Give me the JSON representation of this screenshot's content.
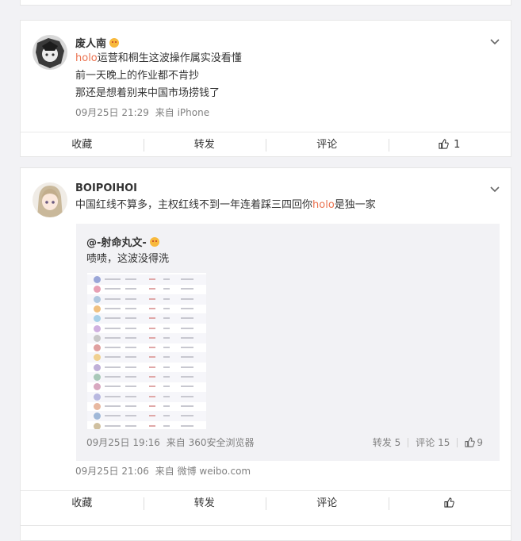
{
  "top_bar": {
    "labels": [
      "收藏",
      "转发",
      "评论"
    ]
  },
  "post1": {
    "author": "废人南",
    "line1_highlight": "holo",
    "line1_rest": "运营和桐生这波操作属实没看懂",
    "line2": "前一天晚上的作业都不肯抄",
    "line3": "那还是想着别来中国市场捞钱了",
    "time": "09月25日 21:29",
    "source": "来自 iPhone",
    "actions": {
      "collect": "收藏",
      "repost": "转发",
      "comment": "评论",
      "likes": "1"
    }
  },
  "post2": {
    "author": "BOIPOIHOI",
    "text_a": "中国红线不算多，主权红线不到一年连着踩三四回你",
    "text_highlight": "holo",
    "text_b": "是独一家",
    "time": "09月25日 21:06",
    "source": "来自 微博 weibo.com",
    "repost": {
      "author": "@-射命丸文-",
      "text": "啧啧，这波没得洗",
      "time": "09月25日 19:16",
      "source": "来自 360安全浏览器",
      "reposts": "转发 5",
      "comments": "评论 15",
      "likes": "9",
      "image_rows": 16
    },
    "actions": {
      "collect": "收藏",
      "repost": "转发",
      "comment": "评论"
    }
  },
  "colors": {
    "highlight": "#eb7350",
    "meta": "#808080",
    "bg": "#f2f2f5"
  }
}
